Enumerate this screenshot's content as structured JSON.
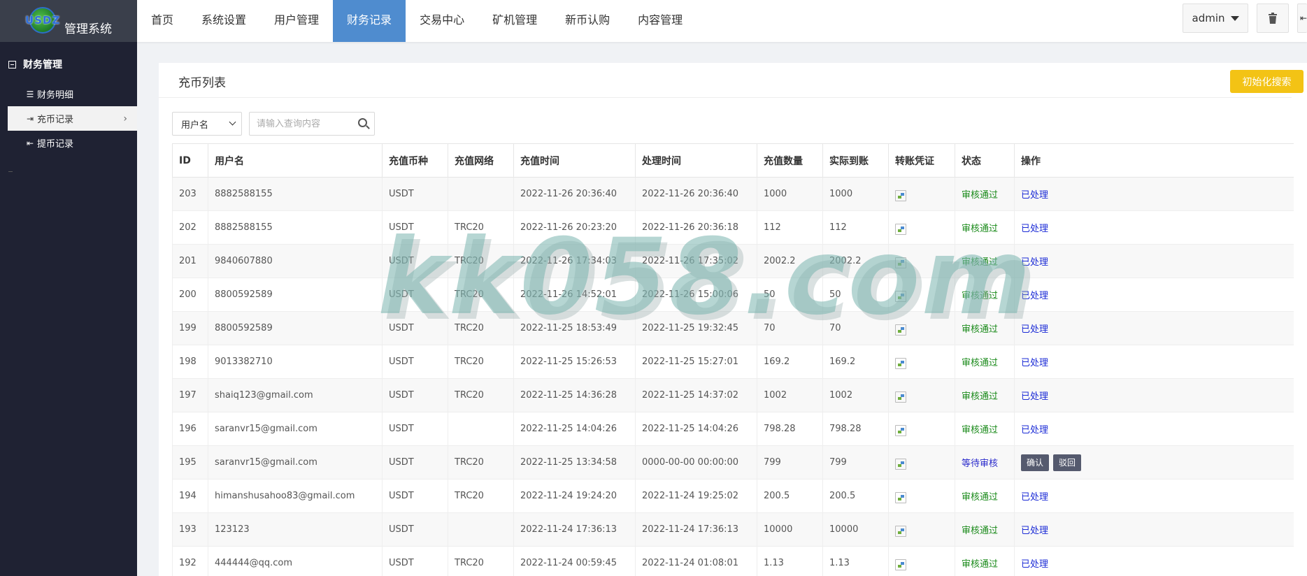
{
  "app": {
    "logo_mark": "USDZ",
    "title": "管理系统"
  },
  "sidebar": {
    "group": "财务管理",
    "items": [
      {
        "label": "财务明细",
        "icon": "list-icon"
      },
      {
        "label": "充币记录",
        "icon": "sign-in-icon"
      },
      {
        "label": "提币记录",
        "icon": "sign-out-icon"
      }
    ]
  },
  "nav": [
    "首页",
    "系统设置",
    "用户管理",
    "财务记录",
    "交易中心",
    "矿机管理",
    "新币认购",
    "内容管理"
  ],
  "nav_active_index": 3,
  "topright": {
    "user": "admin",
    "trash_icon": "trash-icon",
    "exit_icon": "sign-out-icon"
  },
  "panel": {
    "title": "充币列表",
    "reset_button": "初始化搜索"
  },
  "filter": {
    "field_select": "用户名",
    "search_placeholder": "请输入查询内容"
  },
  "table": {
    "headers": [
      "ID",
      "用户名",
      "充值币种",
      "充值网络",
      "充值时间",
      "处理时间",
      "充值数量",
      "实际到账",
      "转账凭证",
      "状态",
      "操作"
    ],
    "rows": [
      {
        "id": "203",
        "user": "8882588155",
        "coin": "USDT",
        "net": "",
        "time": "2022-11-26 20:36:40",
        "proc": "2022-11-26 20:36:40",
        "amount": "1000",
        "received": "1000",
        "status": "审核通过",
        "op": "已处理"
      },
      {
        "id": "202",
        "user": "8882588155",
        "coin": "USDT",
        "net": "TRC20",
        "time": "2022-11-26 20:23:20",
        "proc": "2022-11-26 20:36:18",
        "amount": "112",
        "received": "112",
        "status": "审核通过",
        "op": "已处理"
      },
      {
        "id": "201",
        "user": "9840607880",
        "coin": "USDT",
        "net": "TRC20",
        "time": "2022-11-26 17:34:03",
        "proc": "2022-11-26 17:35:02",
        "amount": "2002.2",
        "received": "2002.2",
        "status": "审核通过",
        "op": "已处理"
      },
      {
        "id": "200",
        "user": "8800592589",
        "coin": "USDT",
        "net": "TRC20",
        "time": "2022-11-26 14:52:01",
        "proc": "2022-11-26 15:00:06",
        "amount": "50",
        "received": "50",
        "status": "审核通过",
        "op": "已处理"
      },
      {
        "id": "199",
        "user": "8800592589",
        "coin": "USDT",
        "net": "TRC20",
        "time": "2022-11-25 18:53:49",
        "proc": "2022-11-25 19:32:45",
        "amount": "70",
        "received": "70",
        "status": "审核通过",
        "op": "已处理"
      },
      {
        "id": "198",
        "user": "9013382710",
        "coin": "USDT",
        "net": "TRC20",
        "time": "2022-11-25 15:26:53",
        "proc": "2022-11-25 15:27:01",
        "amount": "169.2",
        "received": "169.2",
        "status": "审核通过",
        "op": "已处理"
      },
      {
        "id": "197",
        "user": "shaiq123@gmail.com",
        "coin": "USDT",
        "net": "TRC20",
        "time": "2022-11-25 14:36:28",
        "proc": "2022-11-25 14:37:02",
        "amount": "1002",
        "received": "1002",
        "status": "审核通过",
        "op": "已处理"
      },
      {
        "id": "196",
        "user": "saranvr15@gmail.com",
        "coin": "USDT",
        "net": "",
        "time": "2022-11-25 14:04:26",
        "proc": "2022-11-25 14:04:26",
        "amount": "798.28",
        "received": "798.28",
        "status": "审核通过",
        "op": "已处理"
      },
      {
        "id": "195",
        "user": "saranvr15@gmail.com",
        "coin": "USDT",
        "net": "TRC20",
        "time": "2022-11-25 13:34:58",
        "proc": "0000-00-00 00:00:00",
        "amount": "799",
        "received": "799",
        "status": "等待审核",
        "op": "",
        "buttons": [
          "确认",
          "驳回"
        ]
      },
      {
        "id": "194",
        "user": "himanshusahoo83@gmail.com",
        "coin": "USDT",
        "net": "TRC20",
        "time": "2022-11-24 19:24:20",
        "proc": "2022-11-24 19:25:02",
        "amount": "200.5",
        "received": "200.5",
        "status": "审核通过",
        "op": "已处理"
      },
      {
        "id": "193",
        "user": "123123",
        "coin": "USDT",
        "net": "",
        "time": "2022-11-24 17:36:13",
        "proc": "2022-11-24 17:36:13",
        "amount": "10000",
        "received": "10000",
        "status": "审核通过",
        "op": "已处理"
      },
      {
        "id": "192",
        "user": "444444@qq.com",
        "coin": "USDT",
        "net": "TRC20",
        "time": "2022-11-24 00:59:45",
        "proc": "2022-11-24 01:08:01",
        "amount": "1.13",
        "received": "1.13",
        "status": "审核通过",
        "op": "已处理"
      }
    ]
  },
  "watermark": "kk058.com",
  "colors": {
    "sidebar_bg": "#1f2233",
    "nav_active": "#4f8ccf",
    "reset_button": "#f3c315",
    "status_ok": "#1a8a1a",
    "status_wait": "#2a2acb",
    "op_link": "#1b2bd6"
  }
}
